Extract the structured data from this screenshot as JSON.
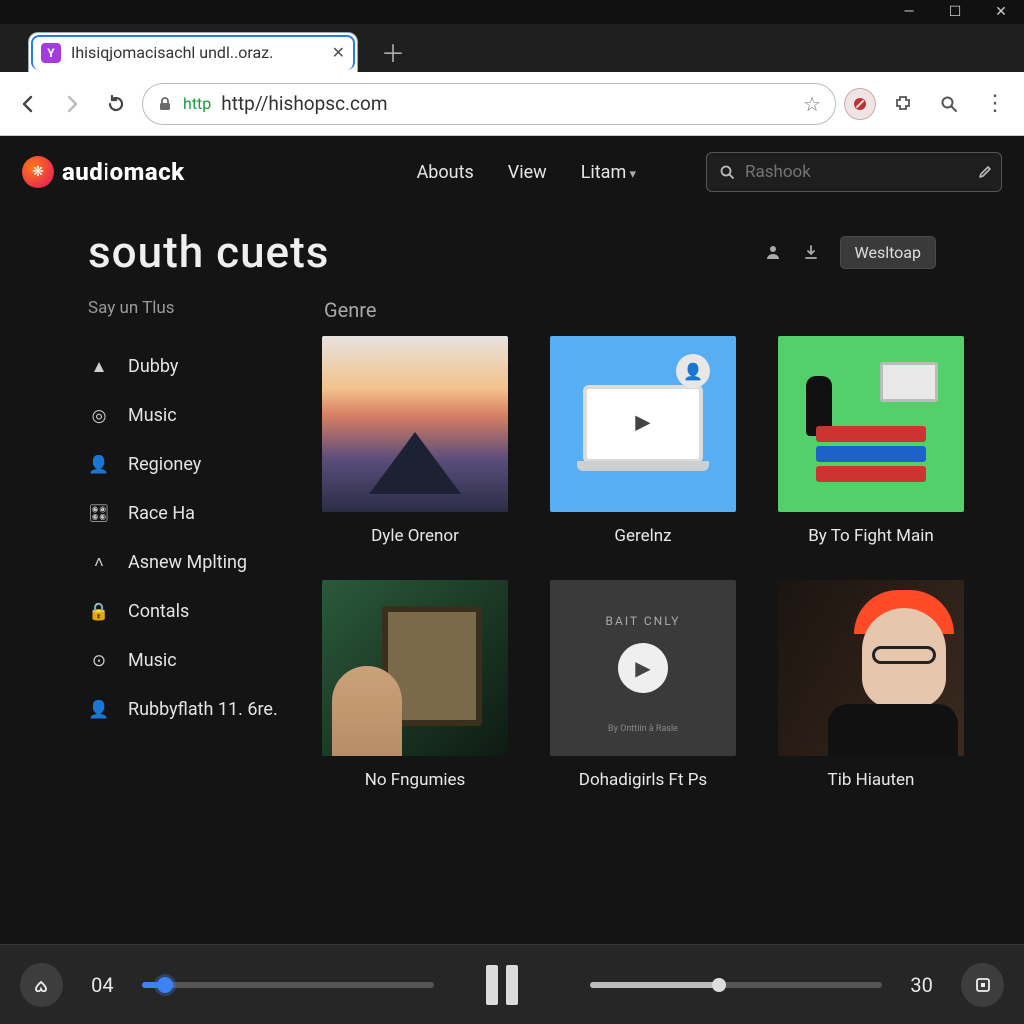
{
  "window": {
    "min": "—",
    "max": "☐",
    "close": "✕"
  },
  "tab": {
    "title": "Ihisiqjomacisachl undl..oraz.",
    "favicon_letter": "Y"
  },
  "toolbar": {
    "url_proto": "http",
    "url_rest": "//hishopsc.com"
  },
  "brand": {
    "name_bold": "aud",
    "name_mid": "i",
    "name_rest": "omack",
    "mark": "❋"
  },
  "nav": {
    "items": [
      {
        "label": "Abouts",
        "dd": false
      },
      {
        "label": "View",
        "dd": false
      },
      {
        "label": "Litam",
        "dd": true
      }
    ]
  },
  "search": {
    "placeholder": "Rashook"
  },
  "page": {
    "title": "south cuets",
    "action_button": "Wesltoap"
  },
  "sidebar": {
    "heading": "Say un Tlus",
    "items": [
      {
        "icon": "▲",
        "label": "Dubby"
      },
      {
        "icon": "◎",
        "label": "Music"
      },
      {
        "icon": "👤",
        "label": "Regioney"
      },
      {
        "icon": "🎛",
        "label": "Race Ha"
      },
      {
        "icon": "˄",
        "label": "Asnew Mplting"
      },
      {
        "icon": "🔒",
        "label": "Contals"
      },
      {
        "icon": "⊙",
        "label": "Music"
      },
      {
        "icon": "👤",
        "label": "Rubbyflath 11. 6re."
      }
    ]
  },
  "section_heading": "Genre",
  "cards": [
    {
      "caption": "Dyle Orenor"
    },
    {
      "caption": "Gerelnz"
    },
    {
      "caption": "By To Fight Main"
    },
    {
      "caption": "No Fngumies"
    },
    {
      "caption": "Dohadigirls Ft Ps",
      "overlay_top": "BAIT CNLY",
      "overlay_bottom": "By Onttiin à Rasle"
    },
    {
      "caption": "Tib Hiauten"
    }
  ],
  "player": {
    "elapsed": "04",
    "total": "30",
    "seek_pct": 8,
    "vol_pct": 44
  }
}
